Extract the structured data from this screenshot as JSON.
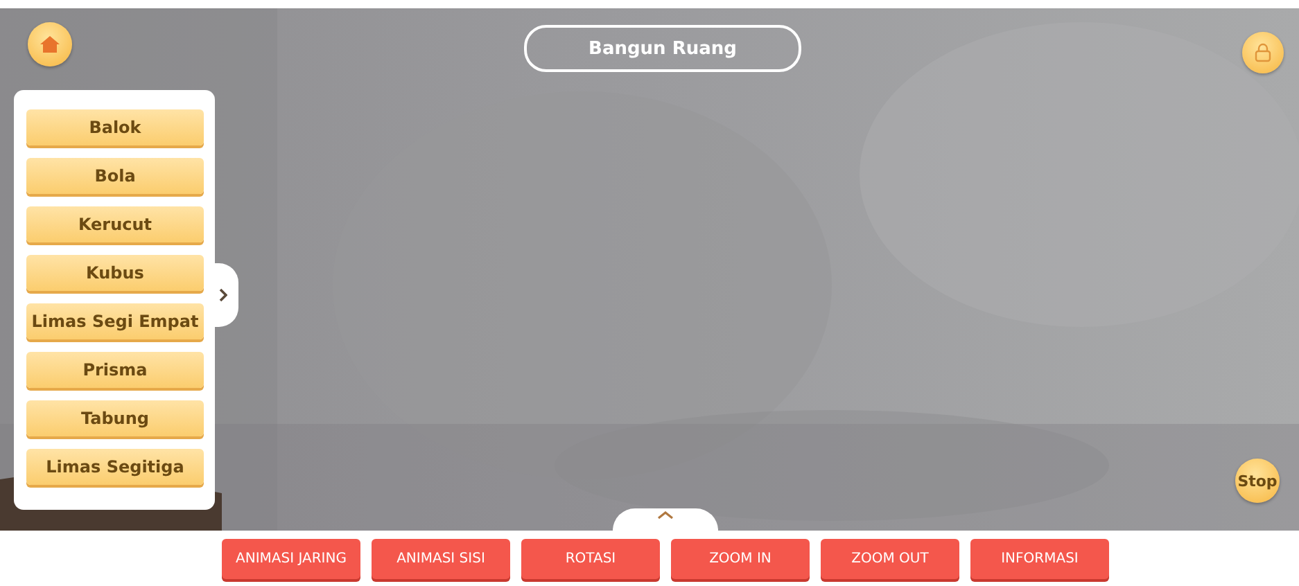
{
  "header": {
    "title": "Bangun Ruang"
  },
  "shape_menu": {
    "expanded": true,
    "items": [
      {
        "label": "Balok"
      },
      {
        "label": "Bola"
      },
      {
        "label": "Kerucut"
      },
      {
        "label": "Kubus"
      },
      {
        "label": "Limas Segi Empat"
      },
      {
        "label": "Prisma"
      },
      {
        "label": "Tabung"
      },
      {
        "label": "Limas Segitiga"
      }
    ]
  },
  "stop_button": {
    "label": "Stop"
  },
  "toolbar": {
    "buttons": [
      {
        "label": "ANIMASI JARING"
      },
      {
        "label": "ANIMASI SISI"
      },
      {
        "label": "ROTASI"
      },
      {
        "label": "ZOOM IN"
      },
      {
        "label": "ZOOM OUT"
      },
      {
        "label": "INFORMASI"
      }
    ]
  }
}
